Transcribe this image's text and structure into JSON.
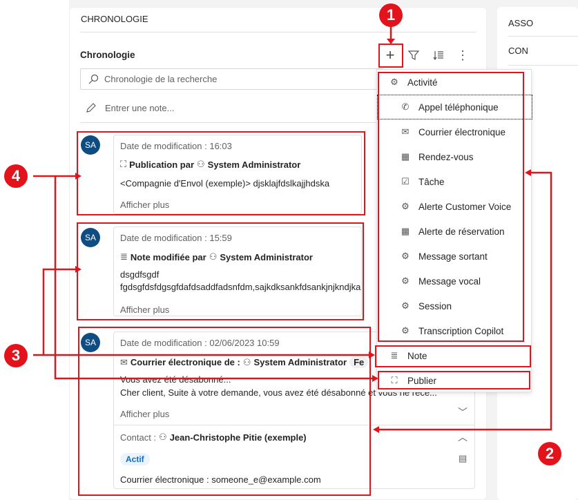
{
  "section_title": "CHRONOLOGIE",
  "right_panel": {
    "label1": "ASSO",
    "label2": "CON"
  },
  "timeline": {
    "title": "Chronologie",
    "search_placeholder": "Chronologie de la recherche",
    "note_placeholder": "Entrer une note...",
    "toolbar": {
      "add": "plus-icon",
      "filter": "filter-icon",
      "sort": "sort-icon",
      "more": "more-icon"
    }
  },
  "records": [
    {
      "avatar": "SA",
      "date": "Date de modification : 16:03",
      "title": "Publication par",
      "author": "System Administrator",
      "line1": "<Compagnie d'Envol (exemple)> djsklajfdslkajjhdska",
      "more": "Afficher plus"
    },
    {
      "avatar": "SA",
      "date": "Date de modification : 15:59",
      "title": "Note modifiée par",
      "author": "System Administrator",
      "line1": "dsgdfsgdf",
      "line2": "fgdsgfdsfdgsgfdafdsaddfadsnfdm,sajkdksankfdsankjnjkndjka",
      "more": "Afficher plus"
    },
    {
      "avatar": "SA",
      "date": "Date de modification : 02/06/2023 10:59",
      "title": "Courrier électronique de :",
      "author": "System Administrator",
      "tag": "Fe",
      "line1": "Vous avez été désabonné...",
      "line2": "Cher client, Suite à votre demande, vous avez été désabonné et vous ne rece...",
      "more": "Afficher plus",
      "contact_label": "Contact :",
      "contact_name": "Jean-Christophe Pitie (exemple)",
      "status": "Actif",
      "email": "Courrier électronique : someone_e@example.com"
    }
  ],
  "menu": {
    "header": "Activité",
    "items": [
      "Appel téléphonique",
      "Courrier électronique",
      "Rendez-vous",
      "Tâche",
      "Alerte Customer Voice",
      "Alerte de réservation",
      "Message sortant",
      "Message vocal",
      "Session",
      "Transcription Copilot"
    ],
    "note": "Note",
    "publish": "Publier"
  },
  "callouts": [
    "1",
    "2",
    "3",
    "4"
  ],
  "colors": {
    "accent": "#e3131b",
    "avatar": "#0f4c81"
  }
}
